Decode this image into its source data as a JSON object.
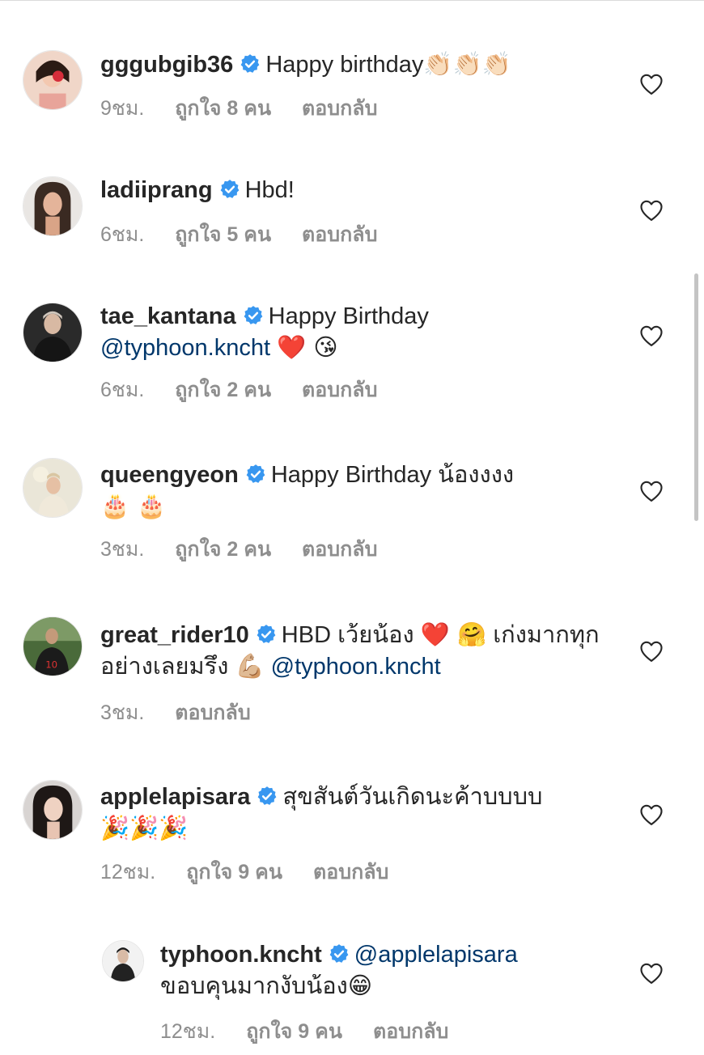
{
  "comments": [
    {
      "username": "gggubgib36",
      "text": "Happy birthday",
      "emoji": "👏🏻👏🏻👏🏻",
      "time": "9ชม.",
      "likes": "ถูกใจ 8 คน",
      "reply": "ตอบกลับ"
    },
    {
      "username": "ladiiprang",
      "text": "Hbd!",
      "time": "6ชม.",
      "likes": "ถูกใจ 5 คน",
      "reply": "ตอบกลับ"
    },
    {
      "username": "tae_kantana",
      "text": "Happy Birthday",
      "mention": "@typhoon.kncht",
      "emoji": "❤️ 😘",
      "time": "6ชม.",
      "likes": "ถูกใจ 2 คน",
      "reply": "ตอบกลับ"
    },
    {
      "username": "queengyeon",
      "text": "Happy Birthday น้องงงง",
      "emoji": "🎂 🎂",
      "time": "3ชม.",
      "likes": "ถูกใจ 2 คน",
      "reply": "ตอบกลับ"
    },
    {
      "username": "great_rider10",
      "text": "HBD เว้ยน้อง",
      "emoji": "❤️ 🤗",
      "text2": "เก่งมากทุกอย่างเลยมรึง",
      "emoji2": "💪🏼",
      "mention": "@typhoon.kncht",
      "time": "3ชม.",
      "reply": "ตอบกลับ"
    },
    {
      "username": "applelapisara",
      "text": "สุขสันต์วันเกิดนะค้าบบบบ",
      "emoji": "🎉🎉🎉",
      "time": "12ชม.",
      "likes": "ถูกใจ 9 คน",
      "reply": "ตอบกลับ"
    }
  ],
  "reply_comment": {
    "username": "typhoon.kncht",
    "mention": "@applelapisara",
    "text": "ขอบคุนมากงับน้อง",
    "emoji": "😁",
    "time": "12ชม.",
    "likes": "ถูกใจ 9 คน",
    "reply": "ตอบกลับ"
  },
  "colors": {
    "text": "#262626",
    "secondary": "#8e8e8e",
    "mention": "#00376b",
    "verified": "#3897f0"
  }
}
